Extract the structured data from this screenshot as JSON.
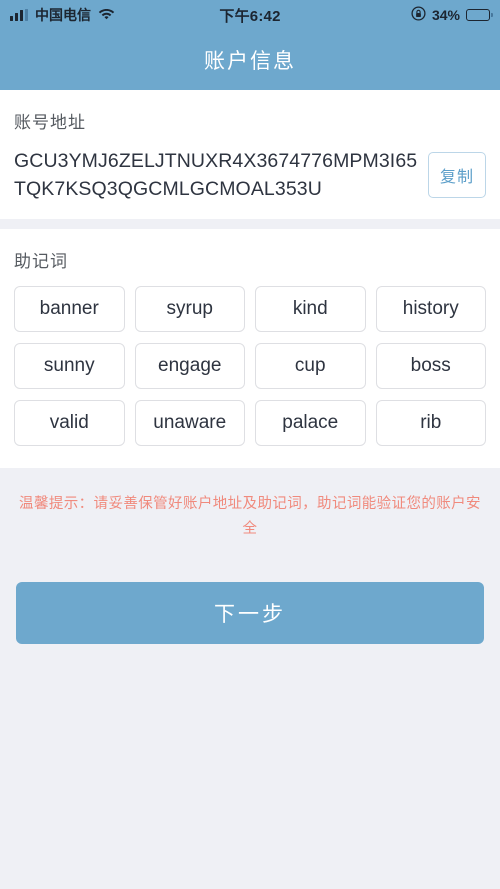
{
  "status_bar": {
    "carrier": "中国电信",
    "time": "下午6:42",
    "battery_percent": "34%",
    "battery_level": 34,
    "icons": [
      "signal-bars-icon",
      "wifi-icon",
      "rotation-lock-icon",
      "battery-icon"
    ]
  },
  "header": {
    "title": "账户信息",
    "background_color": "#6ea8cd",
    "title_color": "#ffffff"
  },
  "account": {
    "section_label": "账号地址",
    "address": "GCU3YMJ6ZELJTNUXR4X3674776MPM3I65TQK7KSQ3QGCMLGCMOAL353U",
    "copy_label": "复制",
    "copy_text_color": "#5b9ec9"
  },
  "mnemonic": {
    "section_label": "助记词",
    "words": [
      "banner",
      "syrup",
      "kind",
      "history",
      "sunny",
      "engage",
      "cup",
      "boss",
      "valid",
      "unaware",
      "palace",
      "rib"
    ]
  },
  "warning": {
    "text": "温馨提示：请妥善保管好账户地址及助记词，助记词能验证您的账户安全",
    "color": "#f08a7d"
  },
  "footer": {
    "next_label": "下一步",
    "next_button_color": "#6ea8cd"
  }
}
